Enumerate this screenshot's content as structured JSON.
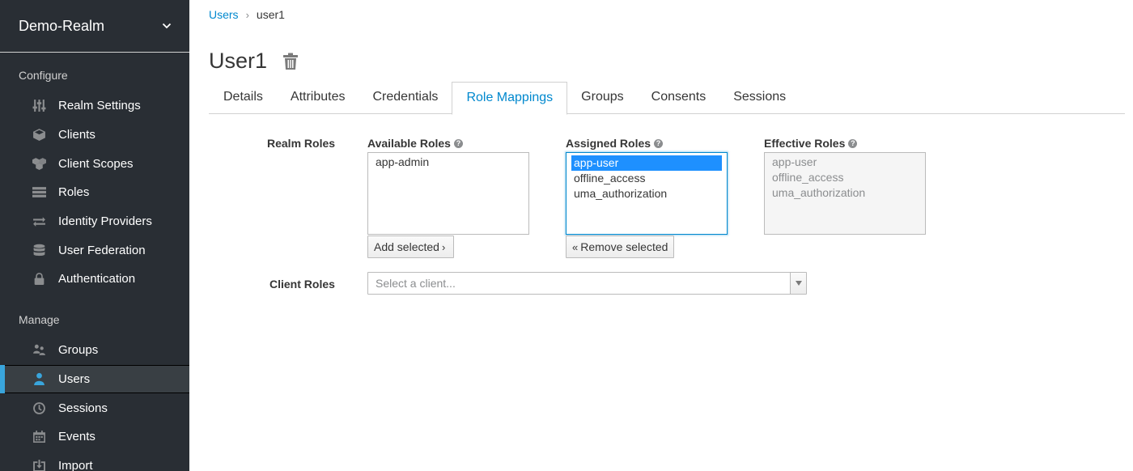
{
  "sidebar": {
    "realm_name": "Demo-Realm",
    "configure_title": "Configure",
    "manage_title": "Manage",
    "configure_items": [
      {
        "label": "Realm Settings",
        "icon": "sliders-icon"
      },
      {
        "label": "Clients",
        "icon": "cube-icon"
      },
      {
        "label": "Client Scopes",
        "icon": "cubes-icon"
      },
      {
        "label": "Roles",
        "icon": "roles-icon"
      },
      {
        "label": "Identity Providers",
        "icon": "exchange-icon"
      },
      {
        "label": "User Federation",
        "icon": "database-icon"
      },
      {
        "label": "Authentication",
        "icon": "lock-icon"
      }
    ],
    "manage_items": [
      {
        "label": "Groups",
        "icon": "users-icon"
      },
      {
        "label": "Users",
        "icon": "user-icon",
        "active": true
      },
      {
        "label": "Sessions",
        "icon": "clock-icon"
      },
      {
        "label": "Events",
        "icon": "calendar-icon"
      },
      {
        "label": "Import",
        "icon": "import-icon"
      }
    ]
  },
  "breadcrumb": {
    "parent": "Users",
    "current": "user1"
  },
  "page": {
    "title": "User1"
  },
  "tabs": [
    {
      "label": "Details"
    },
    {
      "label": "Attributes"
    },
    {
      "label": "Credentials"
    },
    {
      "label": "Role Mappings",
      "active": true
    },
    {
      "label": "Groups"
    },
    {
      "label": "Consents"
    },
    {
      "label": "Sessions"
    }
  ],
  "role_mappings": {
    "realm_roles_label": "Realm Roles",
    "available": {
      "heading": "Available Roles",
      "items": [
        "app-admin"
      ],
      "button": "Add selected"
    },
    "assigned": {
      "heading": "Assigned Roles",
      "items": [
        "app-user",
        "offline_access",
        "uma_authorization"
      ],
      "selected": "app-user",
      "button": "Remove selected"
    },
    "effective": {
      "heading": "Effective Roles",
      "items": [
        "app-user",
        "offline_access",
        "uma_authorization"
      ]
    },
    "client_roles_label": "Client Roles",
    "client_select_placeholder": "Select a client..."
  },
  "colors": {
    "sidebar_bg": "#292e34",
    "accent": "#0088ce",
    "active_indicator": "#39a5dc",
    "selection": "#1e90ff"
  }
}
